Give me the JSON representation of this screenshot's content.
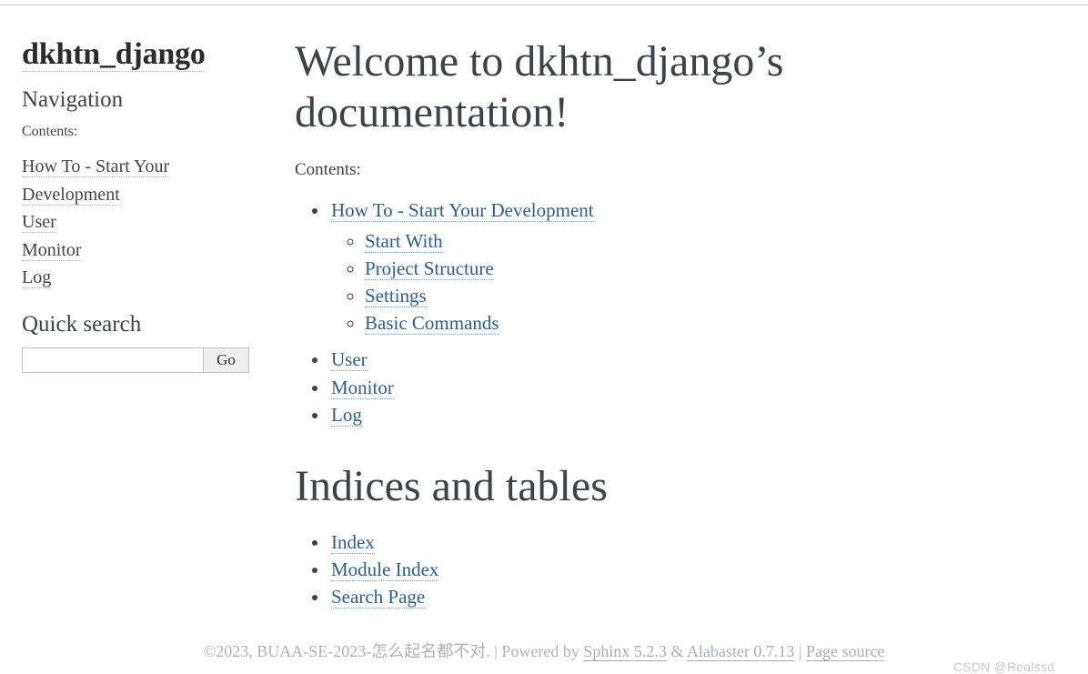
{
  "sidebar": {
    "title": "dkhtn_django",
    "nav_heading": "Navigation",
    "contents_label": "Contents:",
    "nav_items": [
      {
        "label": "How To - Start Your Development"
      },
      {
        "label": "User"
      },
      {
        "label": "Monitor"
      },
      {
        "label": "Log"
      }
    ],
    "search_heading": "Quick search",
    "search_placeholder": "",
    "search_value": "",
    "search_button_label": "Go"
  },
  "main": {
    "heading": "Welcome to dkhtn_django’s documentation!",
    "contents_label": "Contents:",
    "toc": [
      {
        "label": "How To - Start Your Development",
        "children": [
          {
            "label": "Start With"
          },
          {
            "label": "Project Structure"
          },
          {
            "label": "Settings"
          },
          {
            "label": "Basic Commands"
          }
        ]
      },
      {
        "label": "User",
        "children": []
      },
      {
        "label": "Monitor",
        "children": []
      },
      {
        "label": "Log",
        "children": []
      }
    ],
    "indices_heading": "Indices and tables",
    "indices": [
      {
        "label": "Index"
      },
      {
        "label": "Module Index"
      },
      {
        "label": "Search Page"
      }
    ]
  },
  "footer": {
    "copyright": "©2023, BUAA-SE-2023-怎么起名都不对.",
    "sep1": "|",
    "powered_by": "Powered by",
    "sphinx_link": "Sphinx 5.2.3",
    "amp": "&",
    "alabaster_link": "Alabaster 0.7.13",
    "sep2": "|",
    "page_source_link": "Page source",
    "watermark": "CSDN @Realssd"
  },
  "colors": {
    "link": "#2c5f8a",
    "text": "#3e4349",
    "sidebar_link": "#444444",
    "footer_text": "#aeb2b8"
  }
}
